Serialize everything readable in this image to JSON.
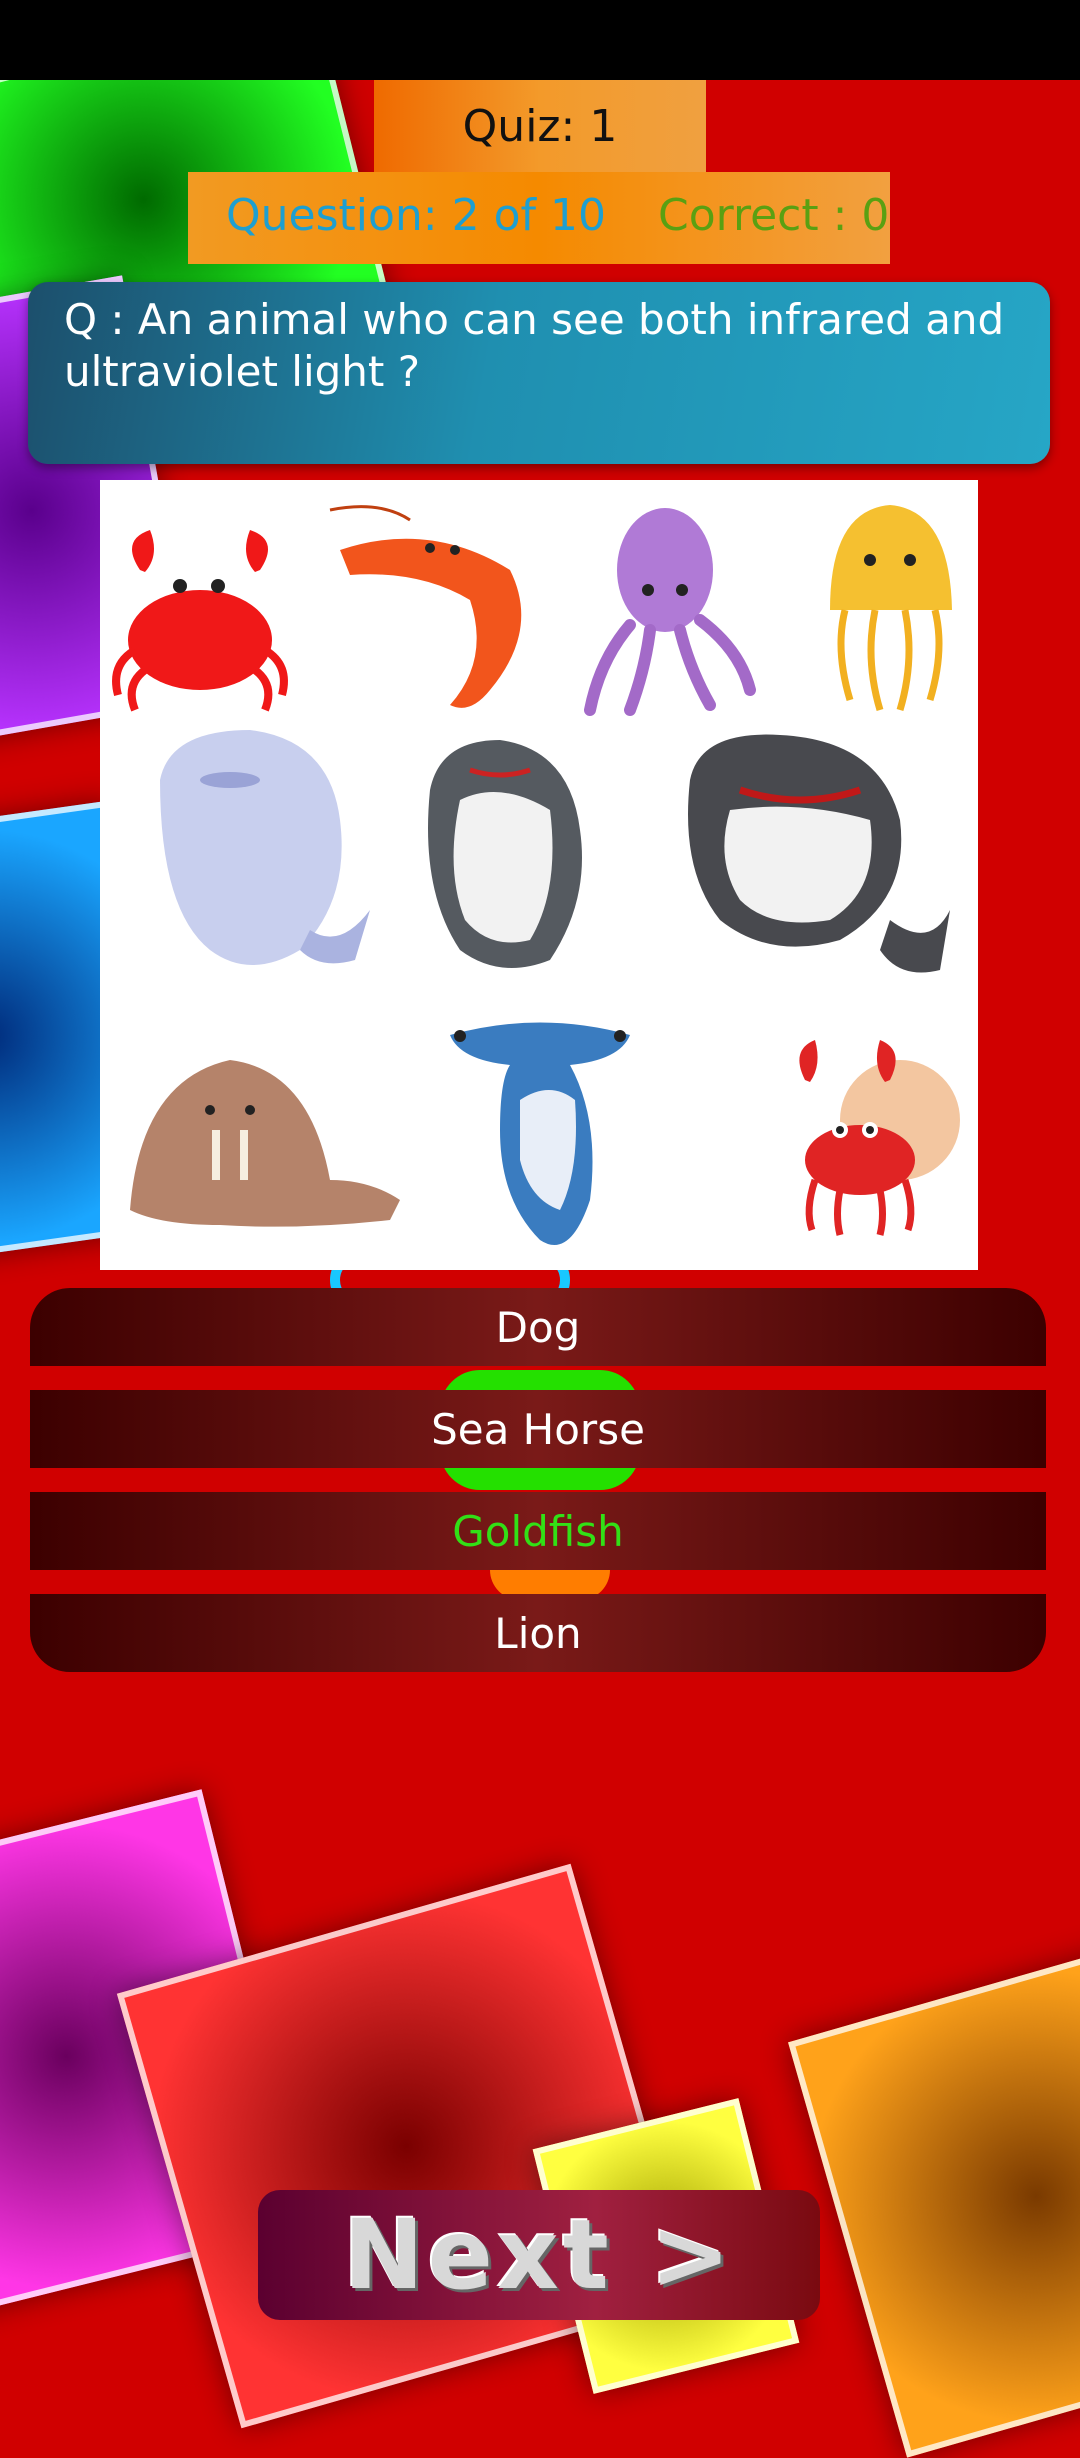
{
  "header": {
    "quiz_label": "Quiz: 1",
    "question_progress": "Question: 2 of 10",
    "correct_count": "Correct : 0"
  },
  "question": {
    "text": "Q : An animal who can see both infrared and ultraviolet light ?"
  },
  "answers": [
    {
      "label": "Dog"
    },
    {
      "label": "Sea Horse"
    },
    {
      "label": "Goldfish"
    },
    {
      "label": "Lion"
    }
  ],
  "next_button": {
    "label": "Next >"
  },
  "colors": {
    "background": "#d00000",
    "header_orange": "#f39a2a",
    "question_progress": "#1e9fd0",
    "correct_count": "#5aa012",
    "question_panel": "#1f8fb0",
    "answer_button": "#5a0e0c",
    "highlighted_answer": "#32e016"
  },
  "illustration": {
    "icon": "sea-animals-illustration"
  }
}
